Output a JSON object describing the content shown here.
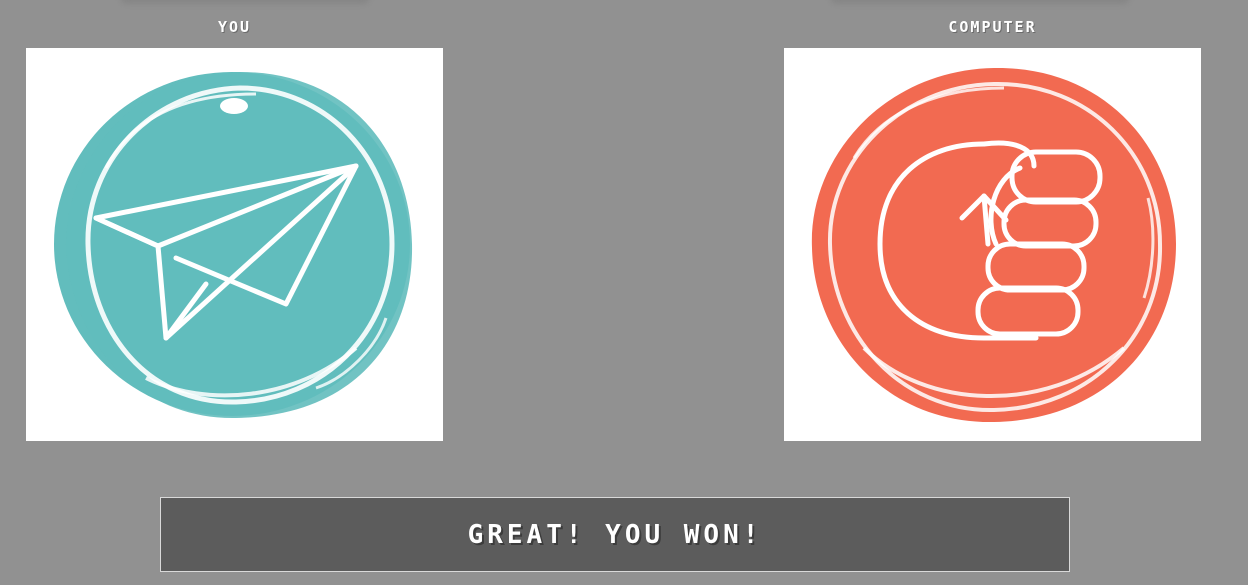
{
  "player": {
    "label": "YOU",
    "choice_icon": "paper-plane-icon",
    "color": "#62bdbd"
  },
  "computer": {
    "label": "COMPUTER",
    "choice_icon": "fist-icon",
    "color": "#f26a51"
  },
  "result": {
    "message": "GREAT! YOU WON!"
  },
  "theme": {
    "background": "#919191",
    "bar": "#5c5c5c",
    "text": "#ffffff"
  }
}
